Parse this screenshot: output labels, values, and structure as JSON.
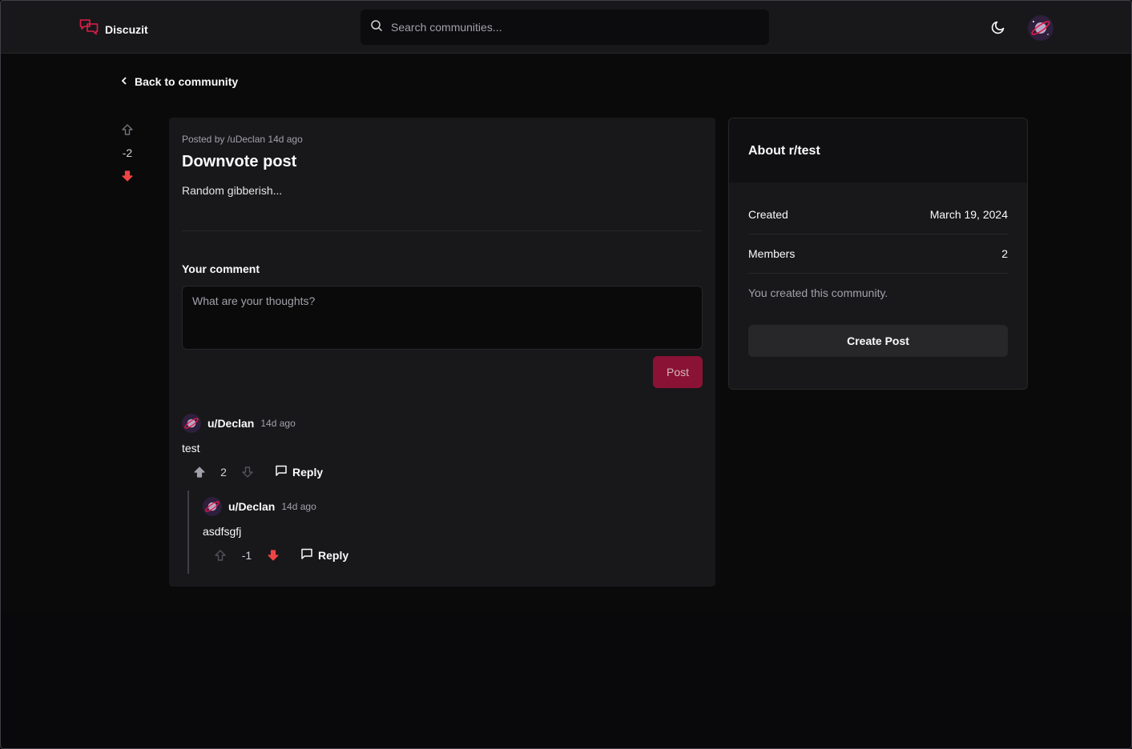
{
  "app": {
    "name": "Discuzit"
  },
  "search": {
    "placeholder": "Search communities..."
  },
  "nav": {
    "back_label": "Back to community"
  },
  "post": {
    "meta": "Posted by /uDeclan 14d ago",
    "title": "Downvote post",
    "body": "Random gibberish...",
    "score": "-2",
    "vote_state": "downvoted"
  },
  "comment_form": {
    "label": "Your comment",
    "placeholder": "What are your thoughts?",
    "submit_label": "Post"
  },
  "comments": [
    {
      "user": "u/Declan",
      "time": "14d ago",
      "text": "test",
      "score": "2",
      "vote_state": "upvoted",
      "reply_label": "Reply",
      "replies": [
        {
          "user": "u/Declan",
          "time": "14d ago",
          "text": "asdfsgfj",
          "score": "-1",
          "vote_state": "downvoted",
          "reply_label": "Reply"
        }
      ]
    }
  ],
  "sidebar": {
    "title": "About r/test",
    "created_label": "Created",
    "created_value": "March 19, 2024",
    "members_label": "Members",
    "members_value": "2",
    "note": "You created this community.",
    "create_label": "Create Post"
  },
  "colors": {
    "brand": "#e11d48",
    "downvote": "#ef4444",
    "upvote_active": "#a1a1aa",
    "post_button": "#9f1239"
  },
  "icons": [
    "logo-icon",
    "search-icon",
    "moon-icon",
    "chevron-left-icon",
    "arrow-up-icon",
    "arrow-down-icon",
    "message-square-icon"
  ]
}
